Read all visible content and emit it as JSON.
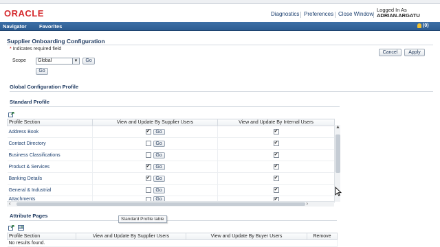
{
  "header": {
    "logo": "ORACLE",
    "links": [
      "Diagnostics",
      "Preferences",
      "Close Window"
    ],
    "logged_in_label": "Logged In As",
    "user": "ADRIAN.ARGATU"
  },
  "navbar": {
    "navigator": "Navigator",
    "favorites": "Favorites",
    "notification_count": "(0)"
  },
  "page": {
    "title": "Supplier Onboarding Configuration",
    "required_note": "Indicates required field",
    "required_star": "*",
    "cancel_label": "Cancel",
    "apply_label": "Apply",
    "scope_label": "Scope",
    "scope_value": "Global",
    "go_label": "Go"
  },
  "sections": {
    "global_profile": "Global Configuration Profile",
    "standard_profile": "Standard Profile",
    "attribute_pages": "Attribute Pages"
  },
  "standard_table": {
    "columns": [
      "Profile Section",
      "View and Update By Supplier Users",
      "View and Update By Internal Users"
    ],
    "rows": [
      {
        "name": "Address Book",
        "supplier": true,
        "internal": true
      },
      {
        "name": "Contact Directory",
        "supplier": false,
        "internal": true
      },
      {
        "name": "Business Classifications",
        "supplier": false,
        "internal": true
      },
      {
        "name": "Product & Services",
        "supplier": true,
        "internal": true
      },
      {
        "name": "Banking Details",
        "supplier": true,
        "internal": true
      },
      {
        "name": "General & Industrial",
        "supplier": false,
        "internal": true
      },
      {
        "name": "Attachments",
        "supplier": false,
        "internal": true
      }
    ],
    "go_label": "Go",
    "tooltip": "Standard Profile table"
  },
  "attribute_table": {
    "columns": [
      "Profile Section",
      "View and Update By Supplier Users",
      "View and Update By Buyer Users",
      "Remove"
    ],
    "empty_text": "No results found."
  },
  "icons": [
    "export-icon",
    "add-row-icon",
    "export-icon",
    "bell-icon",
    "scroll-up-icon",
    "scroll-left-icon",
    "scroll-right-icon"
  ]
}
